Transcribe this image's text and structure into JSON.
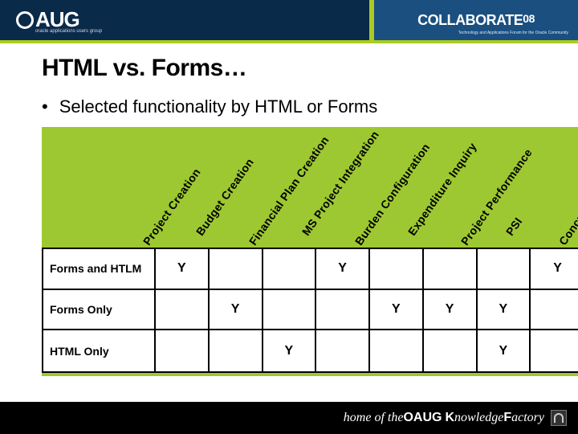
{
  "banner": {
    "logo_text": "AUG",
    "logo_tagline": "oracle applications users group",
    "right_title": "COLLABORATE",
    "right_year": "08",
    "right_subtitle": "Technology and Applications Forum for the Oracle Community"
  },
  "slide": {
    "title": "HTML vs. Forms…",
    "bullet1": "Selected functionality by HTML or Forms"
  },
  "chart_data": {
    "type": "table",
    "title": "Selected functionality by HTML or Forms",
    "categories": [
      "Project Creation",
      "Budget Creation",
      "Financial Plan Creation",
      "MS Project Integration",
      "Burden Configuration",
      "Expenditure Inquiry",
      "Project Performance",
      "PSI",
      "Concurrent Requests"
    ],
    "rows": [
      {
        "name": "Forms and HTLM",
        "values": [
          "Y",
          "",
          "",
          "Y",
          "",
          "",
          "",
          "Y"
        ]
      },
      {
        "name": "Forms Only",
        "values": [
          "",
          "Y",
          "",
          "",
          "Y",
          "Y",
          "Y",
          ""
        ]
      },
      {
        "name": "HTML Only",
        "values": [
          "",
          "",
          "Y",
          "",
          "",
          "",
          "Y",
          ""
        ]
      }
    ],
    "xlabel": "",
    "ylabel": ""
  },
  "footer": {
    "prefix": "home of the ",
    "brand": "OAUG",
    "suffix_part1": "K",
    "suffix_part2": "nowledge ",
    "suffix_part3": "F",
    "suffix_part4": "actory"
  }
}
